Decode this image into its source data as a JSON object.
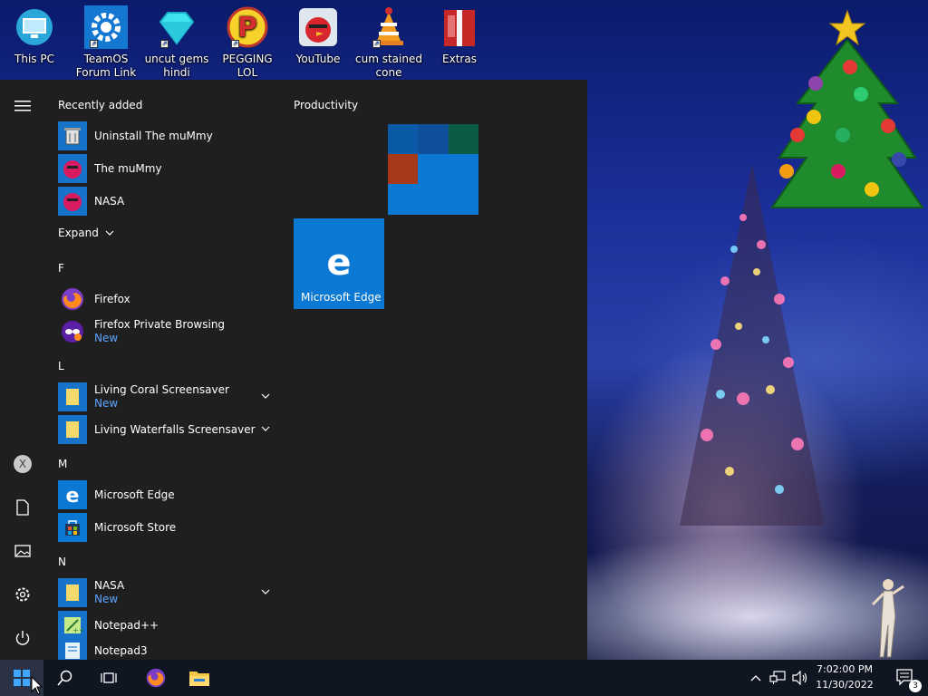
{
  "desktop": {
    "icons": [
      {
        "label": "This PC",
        "icon": "this-pc-icon"
      },
      {
        "label": "TeamOS Forum Link",
        "icon": "gear-icon"
      },
      {
        "label": "uncut gems hindi",
        "icon": "diamond-icon"
      },
      {
        "label": "PEGGING LOL",
        "icon": "p-logo-icon"
      },
      {
        "label": "YouTube",
        "icon": "angry-bird-icon"
      },
      {
        "label": "cum stained cone",
        "icon": "vlc-cone-icon"
      },
      {
        "label": "Extras",
        "icon": "gift-book-icon"
      }
    ]
  },
  "start_menu": {
    "recently_added_label": "Recently added",
    "recent": [
      {
        "name": "Uninstall The muMmy",
        "icon": "uninstall-icon"
      },
      {
        "name": "The muMmy",
        "icon": "mummy-app-icon"
      },
      {
        "name": "NASA",
        "icon": "nasa-app-icon"
      }
    ],
    "expand_label": "Expand",
    "groups": [
      {
        "letter": "F",
        "apps": [
          {
            "name": "Firefox",
            "sub": "",
            "icon": "firefox-icon"
          },
          {
            "name": "Firefox Private Browsing",
            "sub": "New",
            "icon": "firefox-private-icon"
          }
        ]
      },
      {
        "letter": "L",
        "apps": [
          {
            "name": "Living Coral Screensaver",
            "sub": "New",
            "icon": "folder-icon",
            "expandable": true
          },
          {
            "name": "Living Waterfalls Screensaver",
            "sub": "",
            "icon": "folder-icon",
            "expandable": true
          }
        ]
      },
      {
        "letter": "M",
        "apps": [
          {
            "name": "Microsoft Edge",
            "sub": "",
            "icon": "edge-icon"
          },
          {
            "name": "Microsoft Store",
            "sub": "",
            "icon": "store-icon"
          }
        ]
      },
      {
        "letter": "N",
        "apps": [
          {
            "name": "NASA",
            "sub": "New",
            "icon": "folder-icon",
            "expandable": true
          },
          {
            "name": "Notepad++",
            "sub": "",
            "icon": "notepad-plus-icon"
          },
          {
            "name": "Notepad3",
            "sub": "",
            "icon": "notepad3-icon"
          }
        ]
      }
    ],
    "tiles_group_label": "Productivity",
    "edge_tile_label": "Microsoft Edge"
  },
  "taskbar": {
    "time": "7:02:00 PM",
    "date": "11/30/2022",
    "notification_count": "3"
  },
  "colors": {
    "accent": "#0b78d4",
    "menu_bg": "#1f1f1f",
    "taskbar_bg": "#101522",
    "new_badge": "#5aa7ff"
  }
}
